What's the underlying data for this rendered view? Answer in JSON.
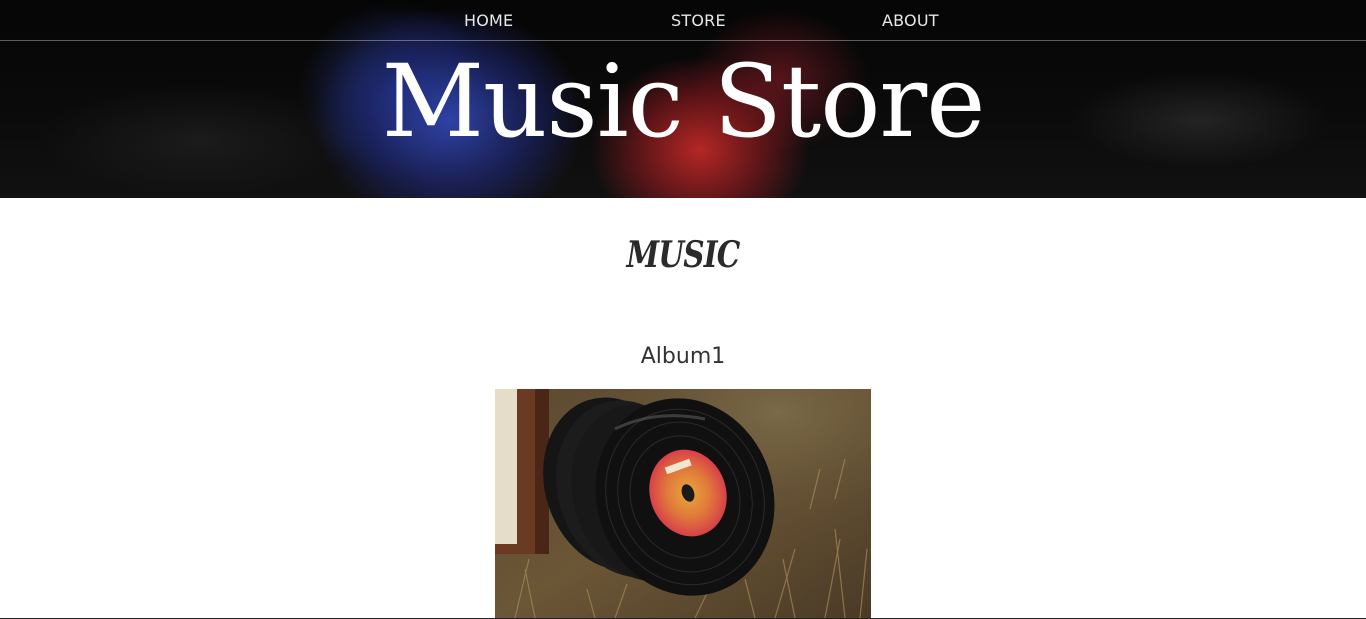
{
  "nav": {
    "items": [
      {
        "label": "HOME"
      },
      {
        "label": "STORE"
      },
      {
        "label": "ABOUT"
      }
    ]
  },
  "header": {
    "title": "Music Store"
  },
  "main": {
    "section_heading": "MUSIC",
    "albums": [
      {
        "title": "Album1",
        "image": "vinyl-records-on-grass"
      }
    ]
  },
  "colors": {
    "header_bg": "#0a0a0a",
    "nav_text": "#e8e8e8",
    "title_text": "#ffffff",
    "body_bg": "#ffffff",
    "heading_text": "#2b2b2b",
    "album_title_text": "#333333"
  }
}
